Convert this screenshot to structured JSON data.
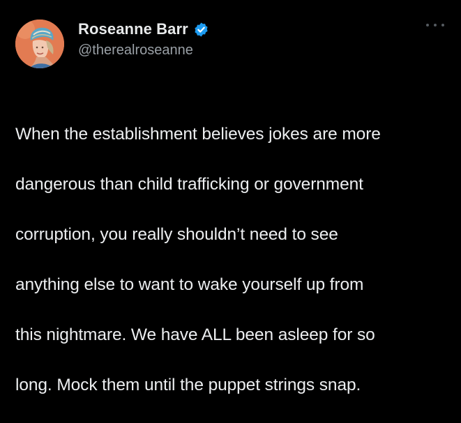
{
  "tweet": {
    "author": {
      "display_name": "Roseanne Barr",
      "handle": "@therealroseanne",
      "verified": true,
      "avatar_icon": "profile-photo",
      "verified_icon": "verified-badge-icon"
    },
    "more_icon": "more-options-icon",
    "text_lines": [
      "When the establishment believes jokes are more",
      "dangerous than child trafficking or government",
      "corruption, you really shouldn’t need to see",
      "anything else to want to wake yourself up from",
      "this nightmare. We have ALL been asleep for so",
      "long. Mock them until the puppet strings snap."
    ]
  },
  "colors": {
    "background": "#000000",
    "text_primary": "#e7e9ea",
    "text_secondary": "#9aa0a6",
    "verified_blue": "#1d9bf0",
    "avatar_bg": "#e07a52"
  }
}
